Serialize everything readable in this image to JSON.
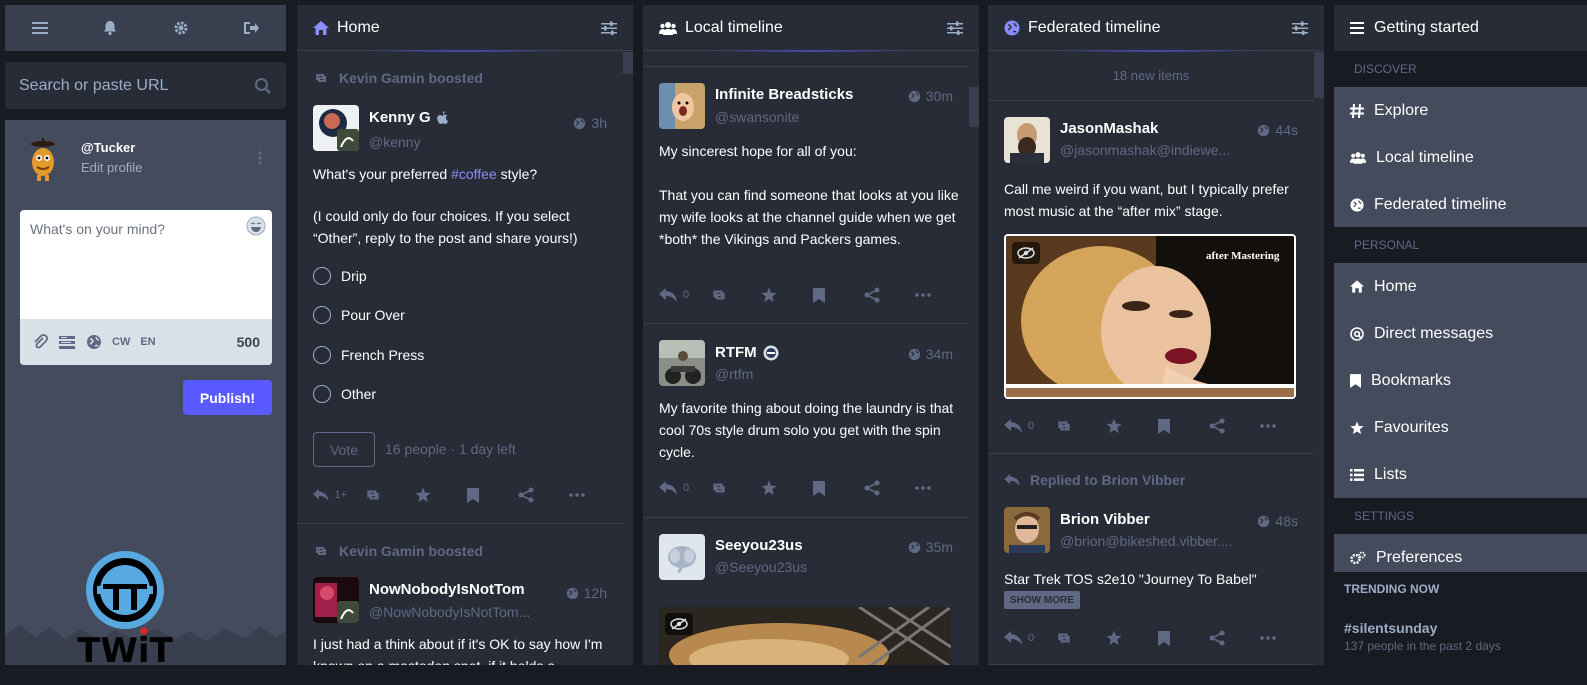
{
  "compose": {
    "nav_icons": [
      "menu-icon",
      "bell-icon",
      "gear-icon",
      "logout-icon"
    ],
    "search_placeholder": "Search or paste URL",
    "account": {
      "handle": "@Tucker",
      "edit": "Edit profile"
    },
    "compose_placeholder": "What's on your mind?",
    "toolbar": {
      "cw": "CW",
      "lang": "EN",
      "count": "500"
    },
    "publish_label": "Publish!"
  },
  "home": {
    "title": "Home",
    "post1": {
      "boosted": "Kevin Gamin boosted",
      "name": "Kenny G",
      "handle": "@kenny",
      "time": "3h",
      "content_before": "What's your preferred ",
      "content_tag": "#coffee",
      "content_after": " style?",
      "content2": "(I could only do four choices. If you select “Other”, reply to the post and share yours!)",
      "poll_options": [
        "Drip",
        "Pour Over",
        "French Press",
        "Other"
      ],
      "vote_label": "Vote",
      "poll_meta": "16 people · 1 day left",
      "reply_count": "1+"
    },
    "post2": {
      "boosted": "Kevin Gamin boosted",
      "name": "NowNobodyIsNotTom",
      "handle": "@NowNobodyIsNotTom...",
      "time": "12h",
      "content": "I just had a think about if it's OK to say how I'm known on a mastodon spot, if it holds a"
    }
  },
  "local": {
    "title": "Local timeline",
    "post1": {
      "name": "Infinite Breadsticks",
      "handle": "@swansonite",
      "time": "30m",
      "content1": "My sincerest hope for all of you:",
      "content2": "That you can find someone that looks at you like my wife looks at the channel guide when we get *both* the Vikings and Packers games.",
      "reply_count": "0"
    },
    "post2": {
      "name": "RTFM",
      "handle": "@rtfm",
      "time": "34m",
      "content": "My favorite thing about doing the laundry is that cool 70s style drum solo you get with the spin cycle.",
      "reply_count": "0"
    },
    "post3": {
      "name": "Seeyou23us",
      "handle": "@Seeyou23us",
      "time": "35m"
    }
  },
  "federated": {
    "title": "Federated timeline",
    "new_items": "18 new items",
    "post1": {
      "name": "JasonMashak",
      "handle": "@jasonmashak@indiewe...",
      "time": "44s",
      "content": "Call me weird if you want, but I typically prefer most music at the “after mix” stage.",
      "media_caption": "after Mastering",
      "reply_count": "0"
    },
    "post2": {
      "replied": "Replied to Brion Vibber",
      "name": "Brion Vibber",
      "handle": "@brion@bikeshed.vibber....",
      "time": "48s",
      "content": "Star Trek TOS s2e10 \"Journey To Babel\"",
      "show_more": "SHOW MORE",
      "reply_count": "0"
    }
  },
  "getting_started": {
    "title": "Getting started",
    "discover": "DISCOVER",
    "explore": "Explore",
    "local": "Local timeline",
    "federated": "Federated timeline",
    "personal": "PERSONAL",
    "home": "Home",
    "dms": "Direct messages",
    "bookmarks": "Bookmarks",
    "favourites": "Favourites",
    "lists": "Lists",
    "settings": "SETTINGS",
    "preferences": "Preferences",
    "trending_header": "TRENDING NOW",
    "trending_tag": "#silentsunday",
    "trending_sub": "137 people in the past 2 days"
  },
  "colors": {
    "accent": "#595aff",
    "bg": "#191b22",
    "column": "#282c37",
    "muted": "#606984",
    "drawer": "#444b5d"
  }
}
